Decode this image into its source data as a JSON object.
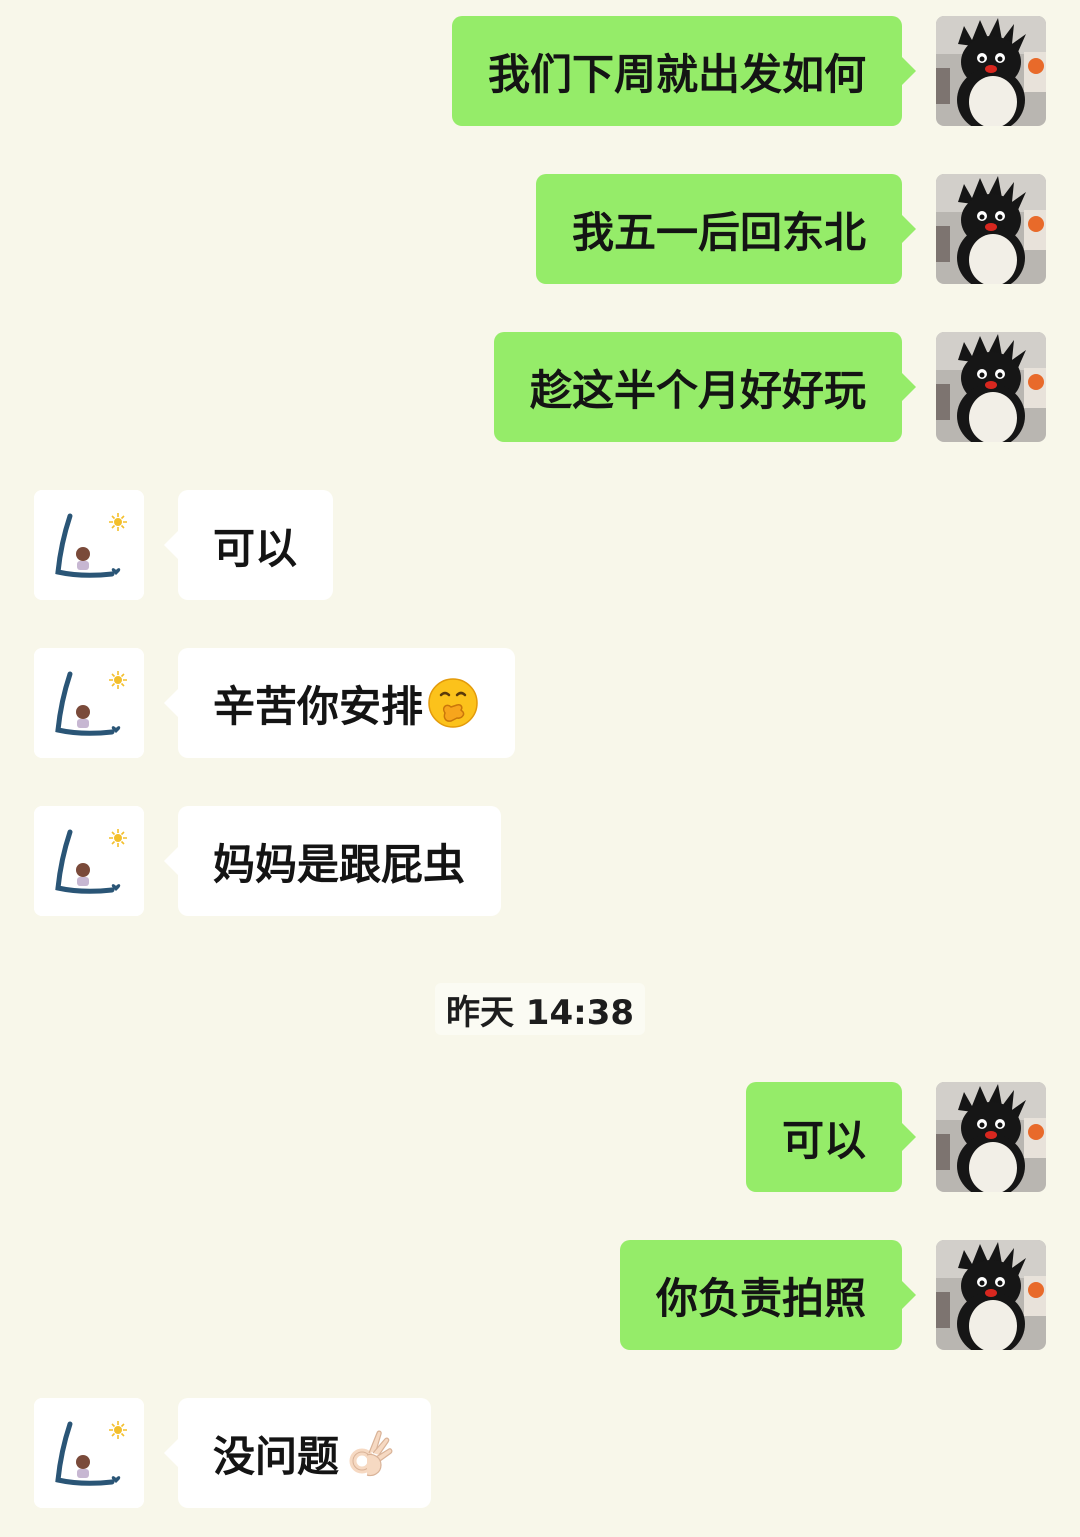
{
  "messages": [
    {
      "from": "me",
      "text": "我们下周就出发如何"
    },
    {
      "from": "me",
      "text": "我五一后回东北"
    },
    {
      "from": "me",
      "text": "趁这半个月好好玩"
    },
    {
      "from": "other",
      "text": "可以"
    },
    {
      "from": "other",
      "text": "辛苦你安排",
      "emoji": "hand-over-mouth-face"
    },
    {
      "from": "other",
      "text": "妈妈是跟屁虫"
    },
    {
      "from": "me",
      "text": "可以"
    },
    {
      "from": "me",
      "text": "你负责拍照"
    },
    {
      "from": "other",
      "text": "没问题",
      "emoji": "ok-hand"
    }
  ],
  "timestamp": "昨天 14:38",
  "colors": {
    "background": "#f8f7ea",
    "outgoing_bubble": "#95ec69",
    "incoming_bubble": "#ffffff"
  },
  "avatars": {
    "me": "penguin-plush-avatar",
    "other": "drawn-letter-avatar"
  }
}
